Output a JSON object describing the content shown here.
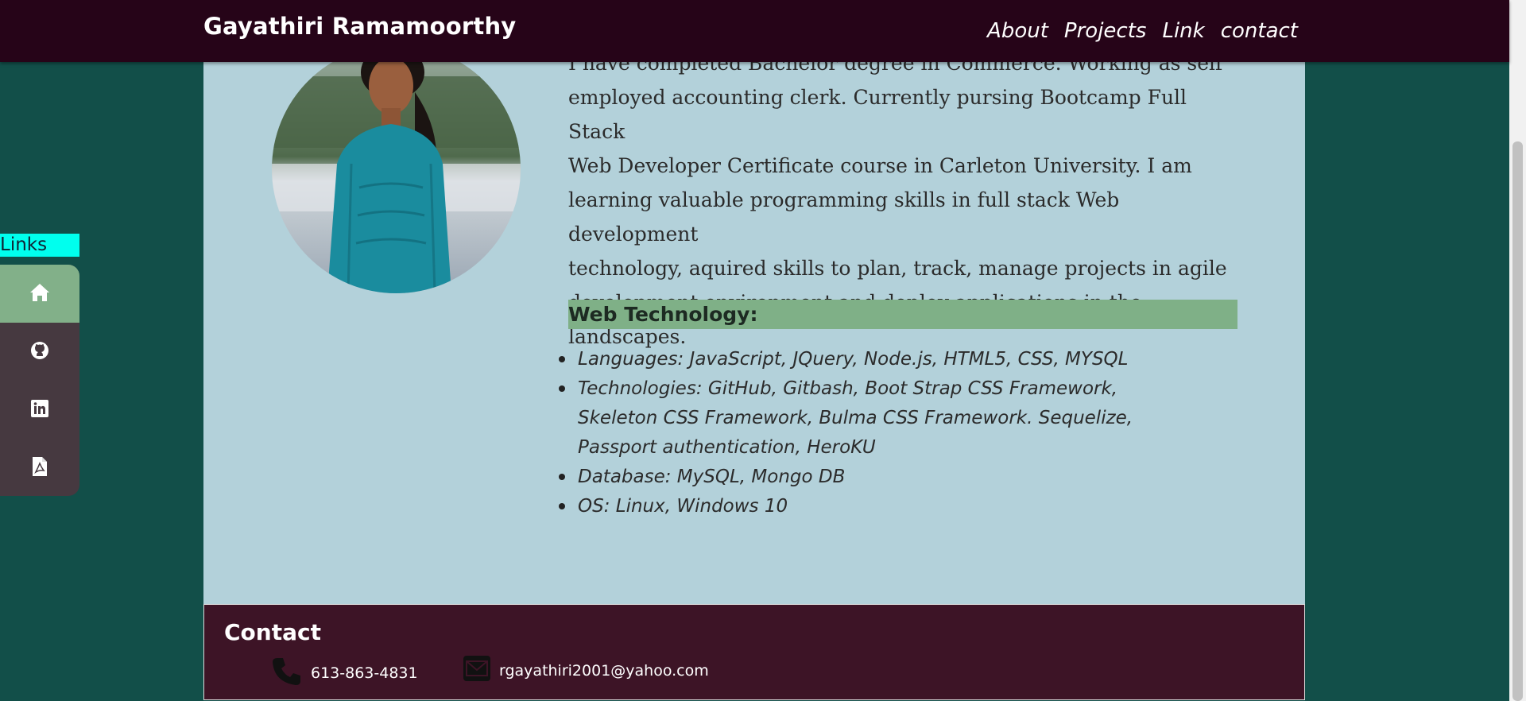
{
  "navbar": {
    "brand": "Gayathiri Ramamoorthy",
    "links": [
      "About",
      "Projects",
      "Link",
      "contact"
    ]
  },
  "sidebar": {
    "label": "Links",
    "items": [
      {
        "icon": "home-icon"
      },
      {
        "icon": "github-icon"
      },
      {
        "icon": "linkedin-icon"
      },
      {
        "icon": "pdf-icon"
      }
    ]
  },
  "about": {
    "bio_lines": [
      "I have completed Bachelor degree in Commerce. Working as self",
      "employed accounting clerk. Currently pursing Bootcamp Full Stack",
      "Web Developer Certificate course in Carleton University. I am",
      "learning valuable programming skills in full stack Web development",
      "technology, aquired skills to plan, track, manage projects in agile",
      "development environment and deploy applications in the",
      "landscapes."
    ],
    "tech_heading": "Web Technology:",
    "tech_items": [
      "Languages: JavaScript, JQuery, Node.js, HTML5, CSS, MYSQL",
      "Technologies: GitHub, Gitbash, Boot Strap CSS Framework, Skeleton CSS Framework, Bulma CSS Framework. Sequelize, Passport authentication, HeroKU",
      "Database: MySQL, Mongo DB",
      "OS: Linux, Windows 10"
    ]
  },
  "contact": {
    "title": "Contact",
    "phone": "613-863-4831",
    "email": "rgayathiri2001@yahoo.com"
  },
  "colors": {
    "navbar": "#260418",
    "page_bg": "#124f49",
    "card_bg": "#b3d1da",
    "footer_bg": "#3d1426",
    "accent_green": "#7fb087",
    "links_label": "#00ffee"
  }
}
